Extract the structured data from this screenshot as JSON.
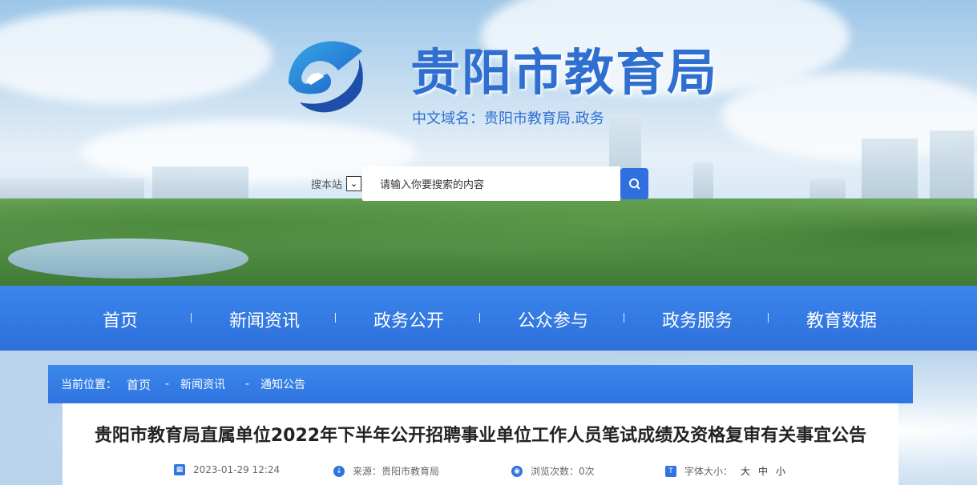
{
  "header": {
    "site_title": "贵阳市教育局",
    "domain_line": "中文域名：贵阳市教育局.政务",
    "brand_color": "#2f6fd0"
  },
  "search": {
    "scope_label": "搜本站",
    "placeholder": "请输入你要搜索的内容",
    "button_icon": "search-icon"
  },
  "nav": {
    "items": [
      "首页",
      "新闻资讯",
      "政务公开",
      "公众参与",
      "政务服务",
      "教育数据"
    ]
  },
  "breadcrumb": {
    "prefix": "当前位置：",
    "items": [
      "首页",
      "新闻资讯",
      "通知公告"
    ],
    "separator": "-"
  },
  "article": {
    "title": "贵阳市教育局直属单位2022年下半年公开招聘事业单位工作人员笔试成绩及资格复审有关事宜公告",
    "date": "2023-01-29 12:24",
    "source": "来源：贵阳市教育局",
    "views": "浏览次数：0次",
    "font_size_label": "字体大小：",
    "font_sizes": [
      "大",
      "中",
      "小"
    ]
  }
}
